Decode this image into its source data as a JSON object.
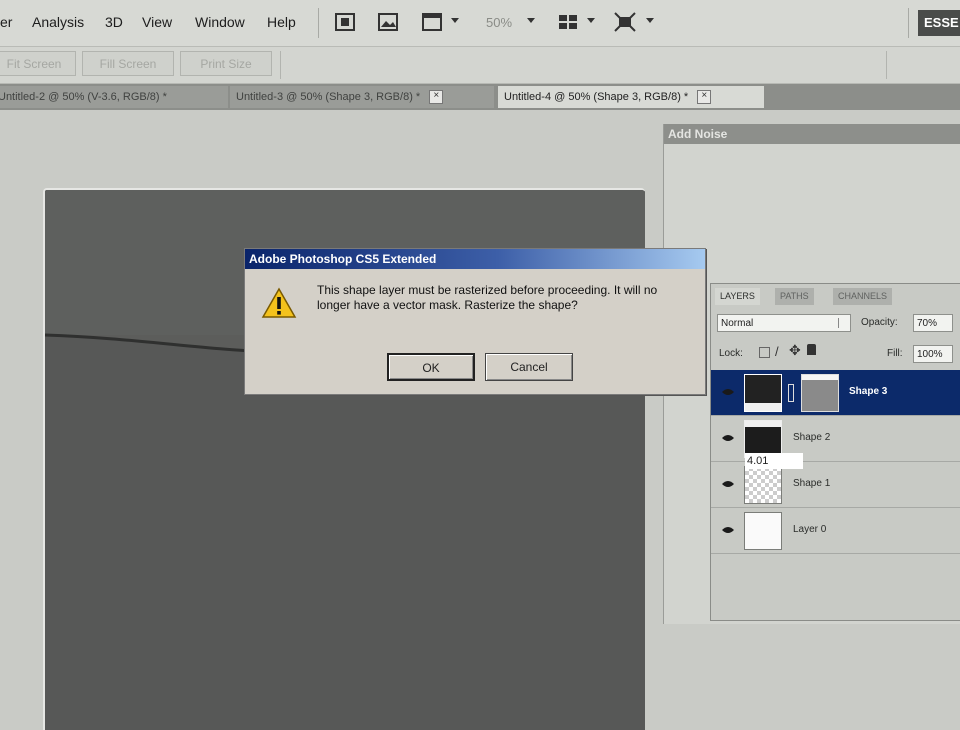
{
  "menu": {
    "items": [
      "er",
      "Analysis",
      "3D",
      "View",
      "Window",
      "Help"
    ],
    "zoom": "50%",
    "workspace": "ESSE"
  },
  "options": {
    "buttons": [
      "Fit Screen",
      "Fill Screen",
      "Print Size"
    ]
  },
  "tabs": [
    {
      "label": "Untitled-2 @ 50% (V-3.6, RGB/8) *"
    },
    {
      "label": "Untitled-3 @ 50% (Shape 3, RGB/8) *"
    },
    {
      "label": "Untitled-4 @ 50% (Shape 3, RGB/8) *"
    }
  ],
  "add_noise": {
    "title": "Add Noise"
  },
  "dialog": {
    "title": "Adobe Photoshop CS5 Extended",
    "message": "This shape layer must be rasterized before proceeding. It will no longer have a vector mask. Rasterize the shape?",
    "ok": "OK",
    "cancel": "Cancel"
  },
  "layers_panel": {
    "tabs": [
      "LAYERS",
      "PATHS",
      "CHANNELS"
    ],
    "blend_mode": "Normal",
    "opacity_label": "Opacity:",
    "opacity": "70%",
    "lock_label": "Lock:",
    "fill_label": "Fill:",
    "fill": "100%",
    "layers": [
      {
        "name": "Shape 3"
      },
      {
        "name": "Shape 2"
      },
      {
        "name": "Shape 1"
      },
      {
        "name": "Layer 0"
      }
    ],
    "tooltip": "4.01"
  }
}
